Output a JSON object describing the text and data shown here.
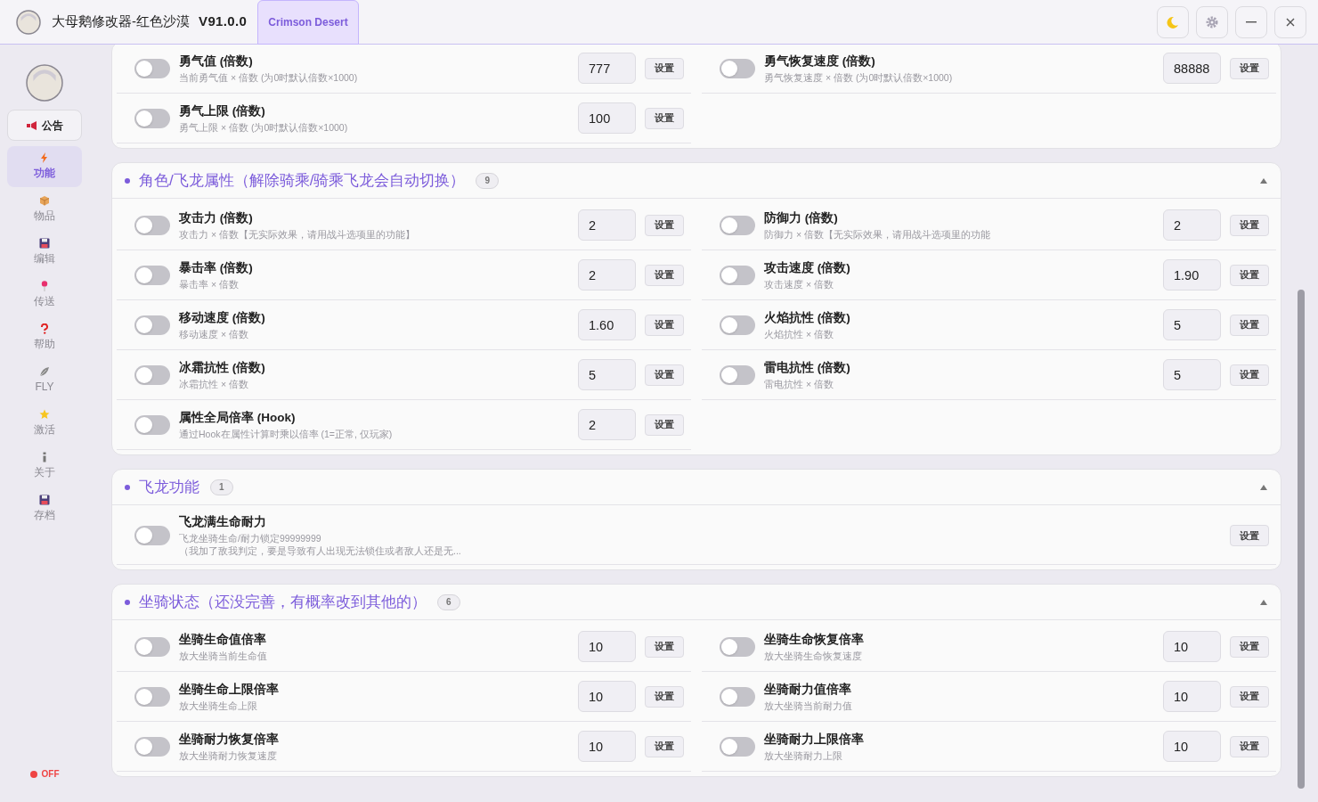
{
  "header": {
    "title": "大母鹅修改器-红色沙漠",
    "version": "V91.0.0",
    "game_tab": {
      "label": "Crimson Desert",
      "selected": true
    },
    "window_buttons": [
      {
        "kind": "theme"
      },
      {
        "kind": "settings"
      },
      {
        "kind": "minimize"
      },
      {
        "kind": "close"
      }
    ]
  },
  "sidebar": {
    "notice": "公告",
    "items": [
      {
        "label": "功能",
        "selected": true
      },
      {
        "label": "物品",
        "selected": false
      },
      {
        "label": "编辑",
        "selected": false
      },
      {
        "label": "传送",
        "selected": false
      },
      {
        "label": "帮助",
        "selected": false
      },
      {
        "label": "FLY",
        "selected": false
      },
      {
        "label": "激活",
        "selected": false
      },
      {
        "label": "关于",
        "selected": false
      },
      {
        "label": "存档",
        "selected": false
      }
    ],
    "status": {
      "label": "OFF",
      "on": false
    }
  },
  "sections": [
    {
      "kind": "grid",
      "rows": [
        {
          "title": "勇气值 (倍数)",
          "desc": "当前勇气值 × 倍数 (为0时默认倍数×1000)",
          "value": "777",
          "button": "设置",
          "on": false
        },
        {
          "title": "勇气恢复速度 (倍数)",
          "desc": "勇气恢复速度 × 倍数 (为0时默认倍数×1000)",
          "value": "88888",
          "button": "设置",
          "on": false
        },
        {
          "title": "勇气上限 (倍数)",
          "desc": "勇气上限 × 倍数 (为0时默认倍数×1000)",
          "value": "100",
          "button": "设置",
          "on": false
        }
      ]
    },
    {
      "title": "角色/飞龙属性（解除骑乘/骑乘飞龙会自动切换）",
      "count": "9",
      "expanded": true,
      "kind": "grid",
      "rows": [
        {
          "title": "攻击力 (倍数)",
          "desc": "攻击力 × 倍数【无实际效果，请用战斗选项里的功能】",
          "value": "2",
          "button": "设置",
          "on": false
        },
        {
          "title": "防御力 (倍数)",
          "desc": "防御力 × 倍数【无实际效果，请用战斗选项里的功能",
          "value": "2",
          "button": "设置",
          "on": false
        },
        {
          "title": "暴击率 (倍数)",
          "desc": "暴击率 × 倍数",
          "value": "2",
          "button": "设置",
          "on": false
        },
        {
          "title": "攻击速度 (倍数)",
          "desc": "攻击速度 × 倍数",
          "value": "1.90",
          "button": "设置",
          "on": false
        },
        {
          "title": "移动速度 (倍数)",
          "desc": "移动速度 × 倍数",
          "value": "1.60",
          "button": "设置",
          "on": false
        },
        {
          "title": "火焰抗性 (倍数)",
          "desc": "火焰抗性 × 倍数",
          "value": "5",
          "button": "设置",
          "on": false
        },
        {
          "title": "冰霜抗性 (倍数)",
          "desc": "冰霜抗性 × 倍数",
          "value": "5",
          "button": "设置",
          "on": false
        },
        {
          "title": "雷电抗性 (倍数)",
          "desc": "雷电抗性 × 倍数",
          "value": "5",
          "button": "设置",
          "on": false
        },
        {
          "title": "属性全局倍率 (Hook)",
          "desc": "通过Hook在属性计算时乘以倍率 (1=正常, 仅玩家)",
          "value": "2",
          "button": "设置",
          "on": false
        }
      ]
    },
    {
      "title": "飞龙功能",
      "count": "1",
      "expanded": true,
      "kind": "list",
      "rows": [
        {
          "title": "飞龙满生命耐力",
          "desc": "飞龙坐骑生命/耐力锁定99999999",
          "note": "（我加了敌我判定，要是导致有人出现无法锁住或者敌人还是无...",
          "button": "设置",
          "on": false
        }
      ]
    },
    {
      "title": "坐骑状态（还没完善，有概率改到其他的）",
      "count": "6",
      "expanded": true,
      "kind": "grid",
      "rows": [
        {
          "title": "坐骑生命值倍率",
          "desc": "放大坐骑当前生命值",
          "value": "10",
          "button": "设置",
          "on": false
        },
        {
          "title": "坐骑生命恢复倍率",
          "desc": "放大坐骑生命恢复速度",
          "value": "10",
          "button": "设置",
          "on": false
        },
        {
          "title": "坐骑生命上限倍率",
          "desc": "放大坐骑生命上限",
          "value": "10",
          "button": "设置",
          "on": false
        },
        {
          "title": "坐骑耐力值倍率",
          "desc": "放大坐骑当前耐力值",
          "value": "10",
          "button": "设置",
          "on": false
        },
        {
          "title": "坐骑耐力恢复倍率",
          "desc": "放大坐骑耐力恢复速度",
          "value": "10",
          "button": "设置",
          "on": false
        },
        {
          "title": "坐骑耐力上限倍率",
          "desc": "放大坐骑耐力上限",
          "value": "10",
          "button": "设置",
          "on": false
        }
      ]
    }
  ]
}
